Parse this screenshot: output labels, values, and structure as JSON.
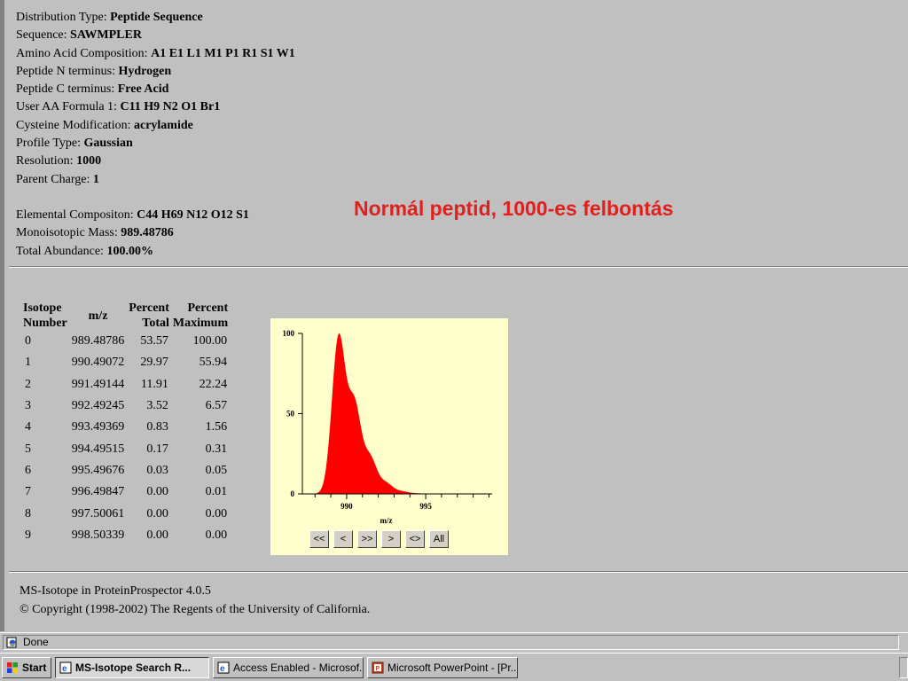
{
  "info": {
    "distribution_type": {
      "label": "Distribution Type:",
      "value": "Peptide Sequence"
    },
    "sequence": {
      "label": "Sequence:",
      "value": "SAWMPLER"
    },
    "aa_composition": {
      "label": "Amino Acid Composition:",
      "value": "A1 E1 L1 M1 P1 R1 S1 W1"
    },
    "n_terminus": {
      "label": "Peptide N terminus:",
      "value": "Hydrogen"
    },
    "c_terminus": {
      "label": "Peptide C terminus:",
      "value": "Free Acid"
    },
    "user_aa_formula": {
      "label": "User AA Formula 1:",
      "value": "C11 H9 N2 O1 Br1"
    },
    "cysteine_mod": {
      "label": "Cysteine Modification:",
      "value": "acrylamide"
    },
    "profile_type": {
      "label": "Profile Type:",
      "value": "Gaussian"
    },
    "resolution": {
      "label": "Resolution:",
      "value": "1000"
    },
    "parent_charge": {
      "label": "Parent Charge:",
      "value": "1"
    },
    "elemental_composition": {
      "label": "Elemental Compositon:",
      "value": "C44 H69 N12 O12 S1"
    },
    "monoisotopic_mass": {
      "label": "Monoisotopic Mass:",
      "value": "989.48786"
    },
    "total_abundance": {
      "label": "Total Abundance:",
      "value": "100.00%"
    }
  },
  "annotation": "Normál peptid, 1000-es felbontás",
  "table": {
    "headers": {
      "isotope_1": "Isotope",
      "isotope_2": "Number",
      "mz": "m/z",
      "pt_1": "Percent",
      "pt_2": "Total",
      "pm_1": "Percent",
      "pm_2": "Maximum"
    },
    "rows": [
      [
        "0",
        "989.48786",
        "53.57",
        "100.00"
      ],
      [
        "1",
        "990.49072",
        "29.97",
        "55.94"
      ],
      [
        "2",
        "991.49144",
        "11.91",
        "22.24"
      ],
      [
        "3",
        "992.49245",
        "3.52",
        "6.57"
      ],
      [
        "4",
        "993.49369",
        "0.83",
        "1.56"
      ],
      [
        "5",
        "994.49515",
        "0.17",
        "0.31"
      ],
      [
        "6",
        "995.49676",
        "0.03",
        "0.05"
      ],
      [
        "7",
        "996.49847",
        "0.00",
        "0.01"
      ],
      [
        "8",
        "997.50061",
        "0.00",
        "0.00"
      ],
      [
        "9",
        "998.50339",
        "0.00",
        "0.00"
      ]
    ]
  },
  "chart_data": {
    "type": "area",
    "xlabel": "m/z",
    "ylabel": "",
    "xlim": [
      987.2,
      999.2
    ],
    "ylim": [
      0,
      100
    ],
    "x_ticks": [
      "990",
      "995"
    ],
    "y_ticks": [
      "0",
      "50",
      "100"
    ],
    "color": "#ff0000",
    "peaks": [
      {
        "x": 989.48786,
        "y": 100.0
      },
      {
        "x": 990.49072,
        "y": 55.94
      },
      {
        "x": 991.49144,
        "y": 22.24
      },
      {
        "x": 992.49245,
        "y": 6.57
      },
      {
        "x": 993.49369,
        "y": 1.56
      },
      {
        "x": 994.49515,
        "y": 0.31
      },
      {
        "x": 995.49676,
        "y": 0.05
      },
      {
        "x": 996.49847,
        "y": 0.01
      },
      {
        "x": 997.50061,
        "y": 0.0
      },
      {
        "x": 998.50339,
        "y": 0.0
      }
    ]
  },
  "nav_buttons": [
    "<<",
    "<",
    ">>",
    ">",
    "<>",
    "All"
  ],
  "footer": {
    "line1": "MS-Isotope in ProteinProspector 4.0.5",
    "line2": "© Copyright (1998-2002) The Regents of the University of California."
  },
  "status": {
    "text": "Done"
  },
  "taskbar": {
    "start": "Start",
    "tasks": [
      "MS-Isotope Search R...",
      "Access Enabled - Microsof...",
      "Microsoft PowerPoint - [Pr..."
    ]
  }
}
